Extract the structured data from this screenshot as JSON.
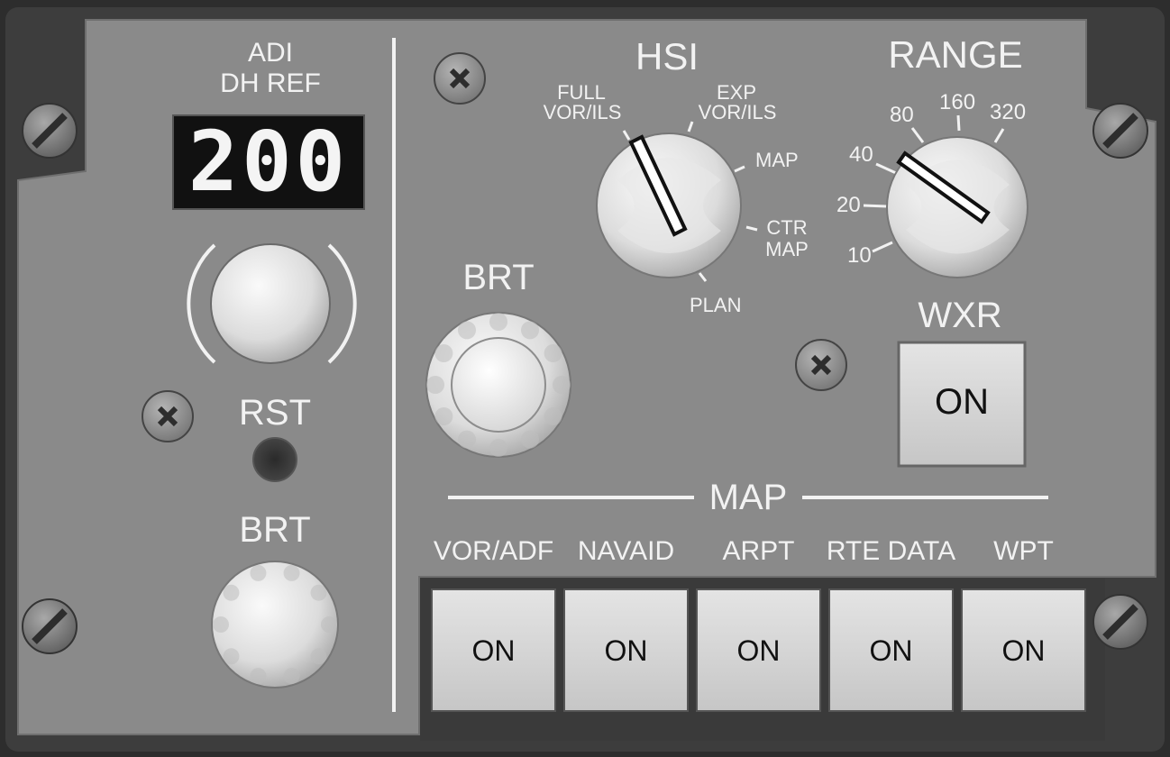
{
  "adi": {
    "title_line1": "ADI",
    "title_line2": "DH REF",
    "display_value": "200",
    "rst_label": "RST",
    "brt_label": "BRT"
  },
  "hsi": {
    "title": "HSI",
    "brt_label": "BRT",
    "modes": {
      "full": "FULL",
      "vor_ils": "VOR/ILS",
      "exp": "EXP",
      "exp_vor_ils": "VOR/ILS",
      "map": "MAP",
      "ctr": "CTR",
      "ctr_map": "MAP",
      "plan": "PLAN"
    },
    "selected_mode": "FULL VOR/ILS"
  },
  "range": {
    "title": "RANGE",
    "values": [
      "10",
      "20",
      "40",
      "80",
      "160",
      "320"
    ],
    "selected": "40"
  },
  "wxr": {
    "title": "WXR",
    "button_label": "ON"
  },
  "map": {
    "title": "MAP",
    "buttons": [
      {
        "label": "VOR/ADF",
        "state": "ON"
      },
      {
        "label": "NAVAID",
        "state": "ON"
      },
      {
        "label": "ARPT",
        "state": "ON"
      },
      {
        "label": "RTE DATA",
        "state": "ON"
      },
      {
        "label": "WPT",
        "state": "ON"
      }
    ]
  },
  "colors": {
    "panel": "#8a8a8a",
    "bezel": "#3a3a3a",
    "label": "#f2f2f2",
    "display_bg": "#111111",
    "button_face": "#d6d6d6"
  }
}
